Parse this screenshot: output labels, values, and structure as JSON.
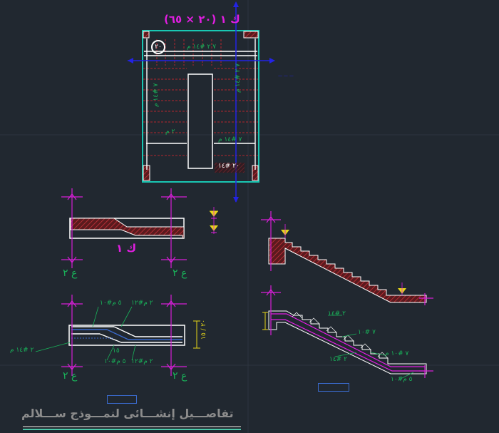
{
  "drawing": {
    "plan_title": "ك ١ (٢٠ × ٦٥)",
    "plan_section_label": "ك ١",
    "circle_number": "٢٠",
    "section_marks": {
      "left_top": "ع ٢",
      "right_top": "ع ٢",
      "left_bottom": "ع ٢",
      "right_bottom": "ع ٢"
    },
    "rebar_labels": {
      "plan_top": "٧ ٢ #١٤ م",
      "plan_left_vert": "٧ #١٤ م",
      "plan_right_vert": "٧ ٢ #١٤ م",
      "plan_bottom": "٢٠ #١٤",
      "plan_left_small": "٢ م",
      "plan_right_small": "٧ #١٤ م",
      "beam_top_left": "٥ م#١٠",
      "beam_top_right": "٢ م#١٢",
      "beam_left": "٢ #١٤ م",
      "beam_bottom_left": "٥ م#١٠",
      "beam_bottom_right": "٢ م#١٢",
      "beam_mid": "١٥",
      "beam_dim": "٢٠ / ١٥",
      "stair_lbl_1": "٢ #١٤",
      "stair_lbl_2": "٧ #١٠",
      "stair_lbl_3": "٧ #١٠ م",
      "stair_lbl_4": "٢ #١٤",
      "stair_lbl_5": "٥ م#١٠"
    },
    "footer_title": "تفاصـــيل إنشـــائى لنمـــوذج ســـلالم"
  },
  "colors": {
    "background": "#212830",
    "concrete": "#b3262e",
    "outline": "#ffffff",
    "axis": "#2323e6",
    "section_mark": "#d61ed6",
    "rebar_text": "#19b35a",
    "cyan_border": "#19c7b3",
    "level_marker": "#e6d619"
  }
}
